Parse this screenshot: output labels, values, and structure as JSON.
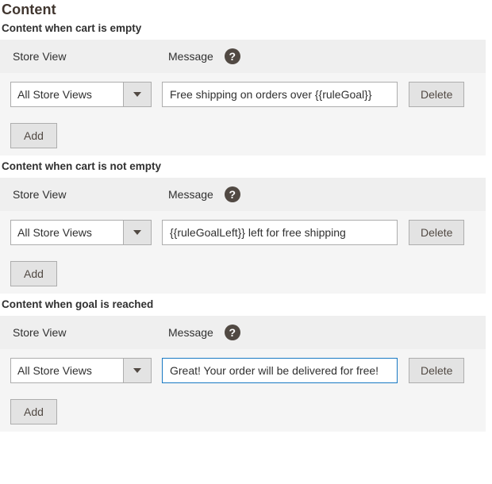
{
  "page": {
    "title": "Content"
  },
  "icons": {
    "help": "help-icon",
    "dropdown_caret": "chevron-down-icon"
  },
  "colors": {
    "header_band": "#efefef",
    "row_band": "#f5f5f5",
    "page_background": "#ffffff",
    "text": "#303030",
    "title_text": "#41362f",
    "button_face": "#e3e3e3",
    "border": "#adadad",
    "focus_border": "#1979c3",
    "help_icon_background": "#514943"
  },
  "common": {
    "column_store_view": "Store View",
    "column_message": "Message",
    "help_glyph": "?",
    "delete_label": "Delete",
    "add_label": "Add",
    "store_view_value": "All Store Views"
  },
  "sections": [
    {
      "label": "Content when cart is empty",
      "columns": {
        "store_view": "Store View",
        "message": "Message"
      },
      "rows": [
        {
          "store_view": "All Store Views",
          "message": "Free shipping on orders over {{ruleGoal}}",
          "focused": false,
          "delete_label": "Delete"
        }
      ],
      "add_label": "Add"
    },
    {
      "label": "Content when cart is not empty",
      "columns": {
        "store_view": "Store View",
        "message": "Message"
      },
      "rows": [
        {
          "store_view": "All Store Views",
          "message": "{{ruleGoalLeft}} left for free shipping",
          "focused": false,
          "delete_label": "Delete"
        }
      ],
      "add_label": "Add"
    },
    {
      "label": "Content when goal is reached",
      "columns": {
        "store_view": "Store View",
        "message": "Message"
      },
      "rows": [
        {
          "store_view": "All Store Views",
          "message": "Great! Your order will be delivered for free!",
          "focused": true,
          "delete_label": "Delete"
        }
      ],
      "add_label": "Add"
    }
  ]
}
